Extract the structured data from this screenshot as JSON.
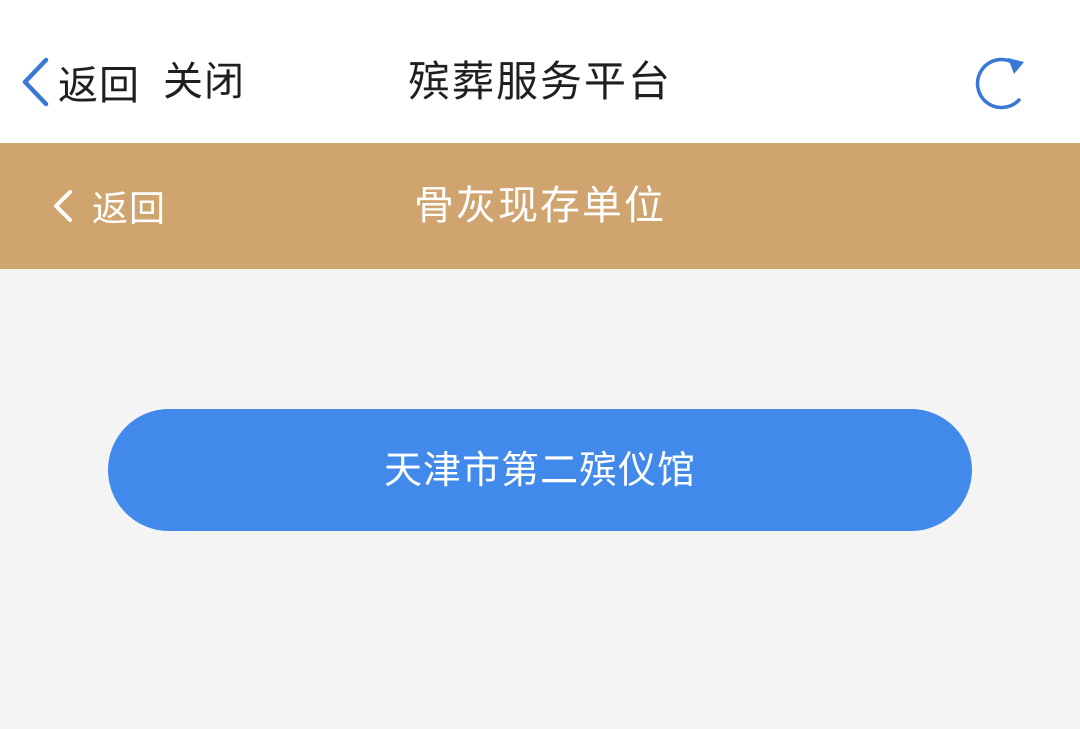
{
  "top_bar": {
    "back_label": "返回",
    "close_label": "关闭",
    "title": "殡葬服务平台",
    "back_icon": "chevron-left-icon",
    "refresh_icon": "refresh-icon",
    "icon_color": "#3a78d6"
  },
  "sub_bar": {
    "back_label": "返回",
    "title": "骨灰现存单位",
    "background_color": "#cfa46f"
  },
  "content": {
    "units": [
      {
        "label": "天津市第二殡仪馆"
      }
    ],
    "button_color": "#4189eb"
  }
}
